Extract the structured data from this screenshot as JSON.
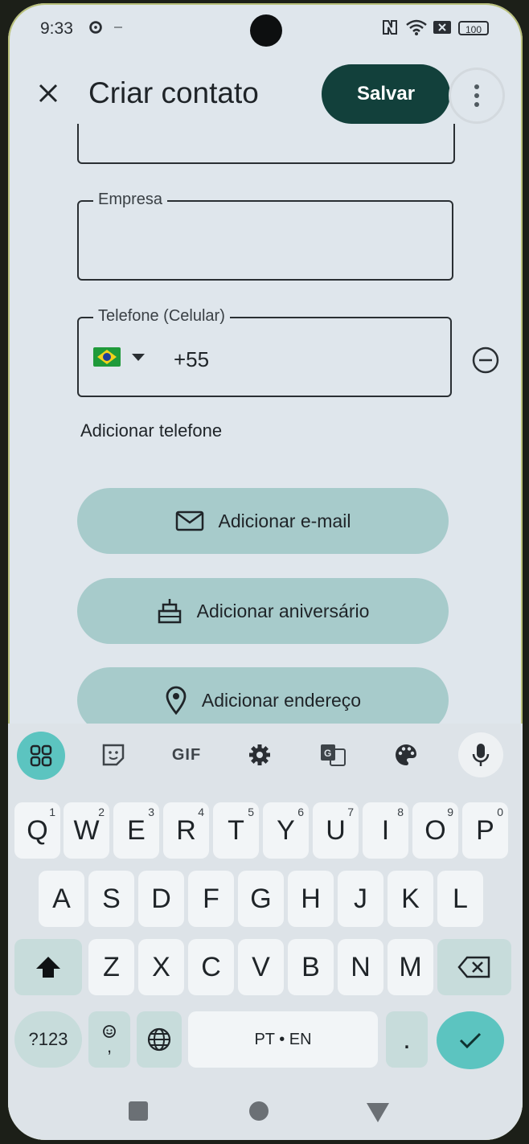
{
  "status": {
    "time": "9:33",
    "battery": "100"
  },
  "header": {
    "title": "Criar contato",
    "save_label": "Salvar"
  },
  "fields": {
    "company_label": "Empresa",
    "phone_label": "Telefone (Celular)",
    "phone_value": "+55"
  },
  "add_phone": "Adicionar telefone",
  "actions": {
    "email": "Adicionar e-mail",
    "birthday": "Adicionar aniversário",
    "address": "Adicionar endereço"
  },
  "keyboard": {
    "toolbar_gif": "GIF",
    "row1": [
      "Q",
      "W",
      "E",
      "R",
      "T",
      "Y",
      "U",
      "I",
      "O",
      "P"
    ],
    "row1_hints": [
      "1",
      "2",
      "3",
      "4",
      "5",
      "6",
      "7",
      "8",
      "9",
      "0"
    ],
    "row2": [
      "A",
      "S",
      "D",
      "F",
      "G",
      "H",
      "J",
      "K",
      "L"
    ],
    "row3": [
      "Z",
      "X",
      "C",
      "V",
      "B",
      "N",
      "M"
    ],
    "symbols_label": "?123",
    "comma_label": ",",
    "space_label": "PT • EN",
    "period_label": "."
  },
  "colors": {
    "accent": "#12403b",
    "pill": "#a7cbcb",
    "kb_accent": "#5cc4c0"
  }
}
